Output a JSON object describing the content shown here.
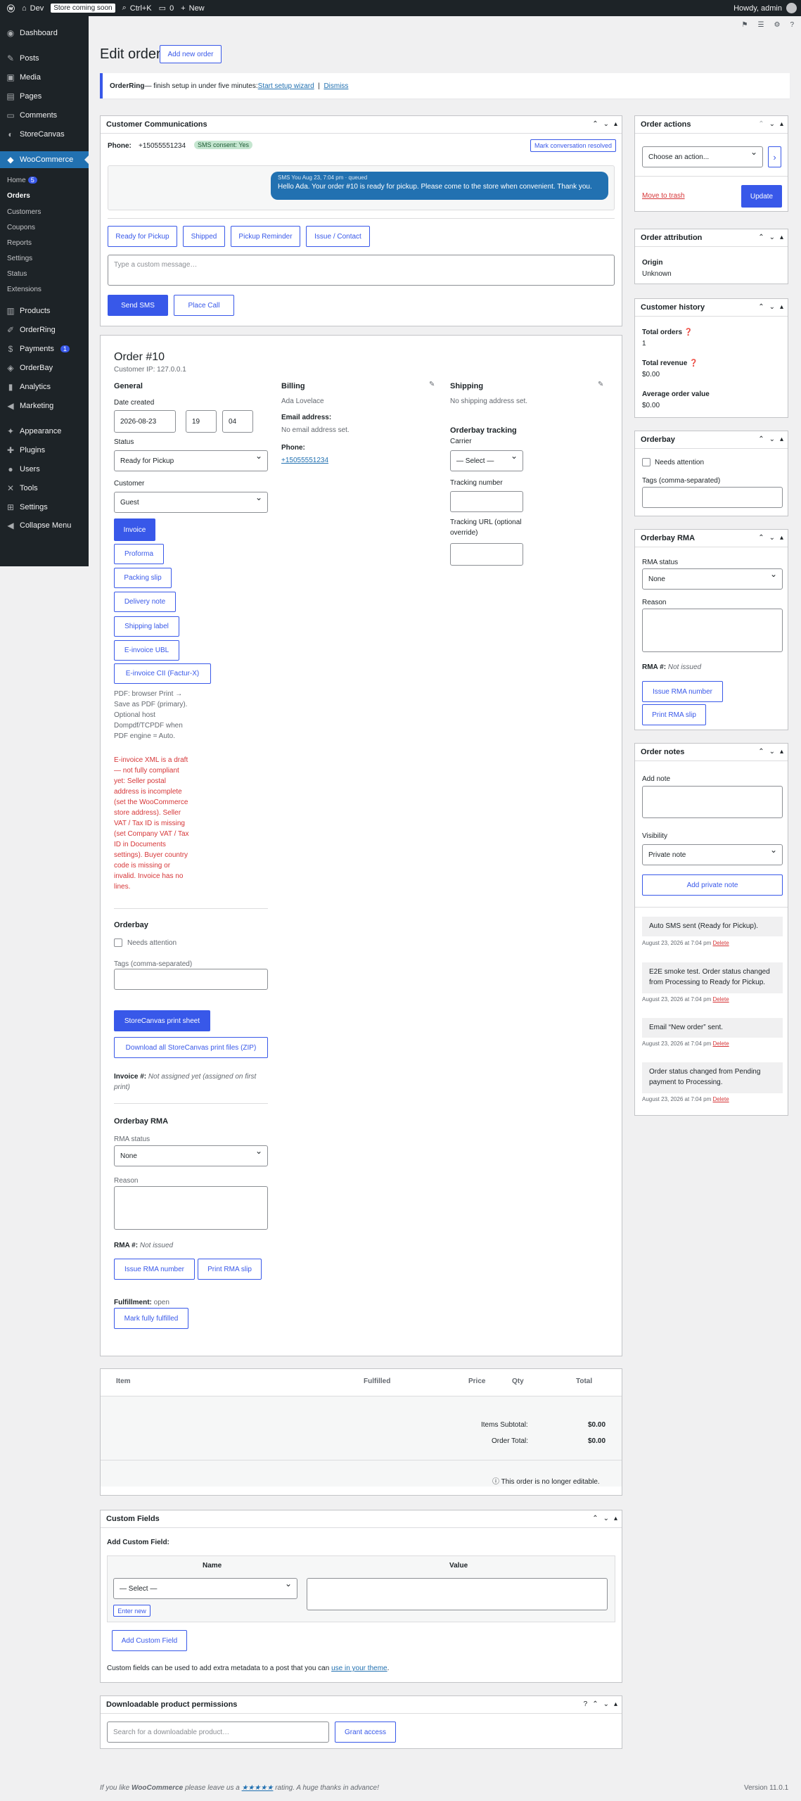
{
  "adminbar": {
    "site": "Dev",
    "coming_soon": "Store coming soon",
    "search_shortcut": "Ctrl+K",
    "comments": "0",
    "new": "New",
    "howdy": "Howdy, admin"
  },
  "sidebar": {
    "items": [
      {
        "label": "Dashboard",
        "icon": "dashboard-icon",
        "glyph": "◉"
      },
      {
        "label": "Posts",
        "icon": "pin-icon",
        "glyph": "✎"
      },
      {
        "label": "Media",
        "icon": "media-icon",
        "glyph": "▣"
      },
      {
        "label": "Pages",
        "icon": "pages-icon",
        "glyph": "▤"
      },
      {
        "label": "Comments",
        "icon": "comment-icon",
        "glyph": "▭"
      },
      {
        "label": "StoreCanvas",
        "icon": "canvas-icon",
        "glyph": "◐"
      },
      {
        "label": "WooCommerce",
        "icon": "woo-icon",
        "glyph": "◆"
      },
      {
        "label": "Products",
        "icon": "products-icon",
        "glyph": "▥"
      },
      {
        "label": "OrderRing",
        "icon": "orderring-icon",
        "glyph": "✐"
      },
      {
        "label": "Payments",
        "icon": "payments-icon",
        "glyph": "$",
        "badge": "1"
      },
      {
        "label": "OrderBay",
        "icon": "orderbay-icon",
        "glyph": "◈"
      },
      {
        "label": "Analytics",
        "icon": "analytics-icon",
        "glyph": "▮"
      },
      {
        "label": "Marketing",
        "icon": "megaphone-icon",
        "glyph": "◀"
      },
      {
        "label": "Appearance",
        "icon": "brush-icon",
        "glyph": "✦"
      },
      {
        "label": "Plugins",
        "icon": "plugin-icon",
        "glyph": "✚"
      },
      {
        "label": "Users",
        "icon": "user-icon",
        "glyph": "●"
      },
      {
        "label": "Tools",
        "icon": "wrench-icon",
        "glyph": "✕"
      },
      {
        "label": "Settings",
        "icon": "settings-icon",
        "glyph": "⊞"
      },
      {
        "label": "Collapse Menu",
        "icon": "collapse-icon",
        "glyph": "◀"
      }
    ],
    "woo_sub": [
      {
        "label": "Home",
        "badge": "5"
      },
      {
        "label": "Orders"
      },
      {
        "label": "Customers"
      },
      {
        "label": "Coupons"
      },
      {
        "label": "Reports"
      },
      {
        "label": "Settings"
      },
      {
        "label": "Status"
      },
      {
        "label": "Extensions"
      }
    ]
  },
  "page": {
    "title": "Edit order",
    "add_new": "Add new order"
  },
  "notice": {
    "brand": "OrderRing",
    "text": " — finish setup in under five minutes: ",
    "link": "Start setup wizard",
    "sep": "|",
    "dismiss": "Dismiss"
  },
  "comms": {
    "title": "Customer Communications",
    "phone_label": "Phone:",
    "phone": "+15055551234",
    "consent": "SMS consent: Yes",
    "resolve": "Mark conversation resolved",
    "msg_meta": "SMS You  Aug 23, 7:04 pm · queued",
    "msg": "Hello Ada. Your order #10 is ready for pickup. Please come to the store when convenient. Thank you.",
    "quick": [
      "Ready for Pickup",
      "Shipped",
      "Pickup Reminder",
      "Issue / Contact"
    ],
    "placeholder": "Type a custom message…",
    "send": "Send SMS",
    "call": "Place Call"
  },
  "order": {
    "title": "Order #10",
    "ip": "Customer IP: 127.0.0.1",
    "general": "General",
    "date_label": "Date created",
    "date": "2026-08-23",
    "hour": "19",
    "minute": "04",
    "status_label": "Status",
    "status": "Ready for Pickup",
    "customer_label": "Customer",
    "customer": "Guest",
    "docs": [
      "Invoice",
      "Proforma",
      "Packing slip",
      "Delivery note",
      "Shipping label",
      "E-invoice UBL",
      "E-invoice CII (Factur-X)"
    ],
    "pdf_note": "PDF: browser Print → Save as PDF (primary). Optional host Dompdf/TCPDF when PDF engine = Auto.",
    "einv_warn": "E-invoice XML is a draft — not fully compliant yet: Seller postal address is incomplete (set the WooCommerce store address). Seller VAT / Tax ID is missing (set Company VAT / Tax ID in Documents settings). Buyer country code is missing or invalid. Invoice has no lines.",
    "orderbay": "Orderbay",
    "needs_attention": "Needs attention",
    "tags_label": "Tags (comma-separated)",
    "print_sheet": "StoreCanvas print sheet",
    "download_zip": "Download all StoreCanvas print files (ZIP)",
    "invoice_label": "Invoice #:",
    "invoice_val": "Not assigned yet (assigned on first print)",
    "rma": "Orderbay RMA",
    "rma_status_label": "RMA status",
    "rma_status": "None",
    "reason_label": "Reason",
    "rma_no_label": "RMA #:",
    "rma_no": "Not issued",
    "issue_rma": "Issue RMA number",
    "print_rma": "Print RMA slip",
    "fulfillment_label": "Fulfillment:",
    "fulfillment": "open",
    "mark_fulfilled": "Mark fully fulfilled",
    "billing": "Billing",
    "billing_name": "Ada Lovelace",
    "email_label": "Email address:",
    "email": "No email address set.",
    "phone_label": "Phone:",
    "phone": "+15055551234",
    "shipping": "Shipping",
    "shipping_addr": "No shipping address set.",
    "tracking": "Orderbay tracking",
    "carrier_label": "Carrier",
    "carrier": "— Select —",
    "tracking_no": "Tracking number",
    "tracking_url": "Tracking URL (optional override)"
  },
  "items": {
    "cols": [
      "Item",
      "Fulfilled",
      "Price",
      "Qty",
      "Total"
    ],
    "subtotal_label": "Items Subtotal:",
    "subtotal": "$0.00",
    "total_label": "Order Total:",
    "total": "$0.00",
    "locked": "This order is no longer editable."
  },
  "custom_fields": {
    "title": "Custom Fields",
    "add_label": "Add Custom Field:",
    "name_col": "Name",
    "value_col": "Value",
    "select": "— Select —",
    "enter_new": "Enter new",
    "add_btn": "Add Custom Field",
    "note": "Custom fields can be used to add extra metadata to a post that you can ",
    "note_link": "use in your theme",
    "note_end": "."
  },
  "downloads": {
    "title": "Downloadable product permissions",
    "placeholder": "Search for a downloadable product…",
    "grant": "Grant access"
  },
  "footer": {
    "pre": "If you like ",
    "brand": "WooCommerce",
    "mid": " please leave us a ",
    "stars": "★★★★★",
    "post": " rating. A huge thanks in advance!",
    "version": "Version 11.0.1"
  },
  "actions": {
    "title": "Order actions",
    "choose": "Choose an action...",
    "go": "›",
    "trash": "Move to trash",
    "update": "Update"
  },
  "attribution": {
    "title": "Order attribution",
    "origin_label": "Origin",
    "origin": "Unknown"
  },
  "history": {
    "title": "Customer history",
    "orders_label": "Total orders",
    "orders": "1",
    "revenue_label": "Total revenue",
    "revenue": "$0.00",
    "avg_label": "Average order value",
    "avg": "$0.00"
  },
  "side_orderbay": {
    "title": "Orderbay",
    "needs": "Needs attention",
    "tags": "Tags (comma-separated)"
  },
  "side_rma": {
    "title": "Orderbay RMA",
    "status_label": "RMA status",
    "status": "None",
    "reason": "Reason",
    "rma_label": "RMA #:",
    "rma_val": "Not issued",
    "issue": "Issue RMA number",
    "print": "Print RMA slip"
  },
  "notes": {
    "title": "Order notes",
    "add_label": "Add note",
    "visibility_label": "Visibility",
    "visibility": "Private note",
    "add_btn": "Add private note",
    "list": [
      {
        "text": "Auto SMS sent (Ready for Pickup).",
        "meta": "August 23, 2026 at 7:04 pm",
        "del": "Delete"
      },
      {
        "text": "E2E smoke test. Order status changed from Processing to Ready for Pickup.",
        "meta": "August 23, 2026 at 7:04 pm",
        "del": "Delete"
      },
      {
        "text": "Email “New order” sent.",
        "meta": "August 23, 2026 at 7:04 pm",
        "del": "Delete"
      },
      {
        "text": "Order status changed from Pending payment to Processing.",
        "meta": "August 23, 2026 at 7:04 pm",
        "del": "Delete"
      }
    ]
  }
}
